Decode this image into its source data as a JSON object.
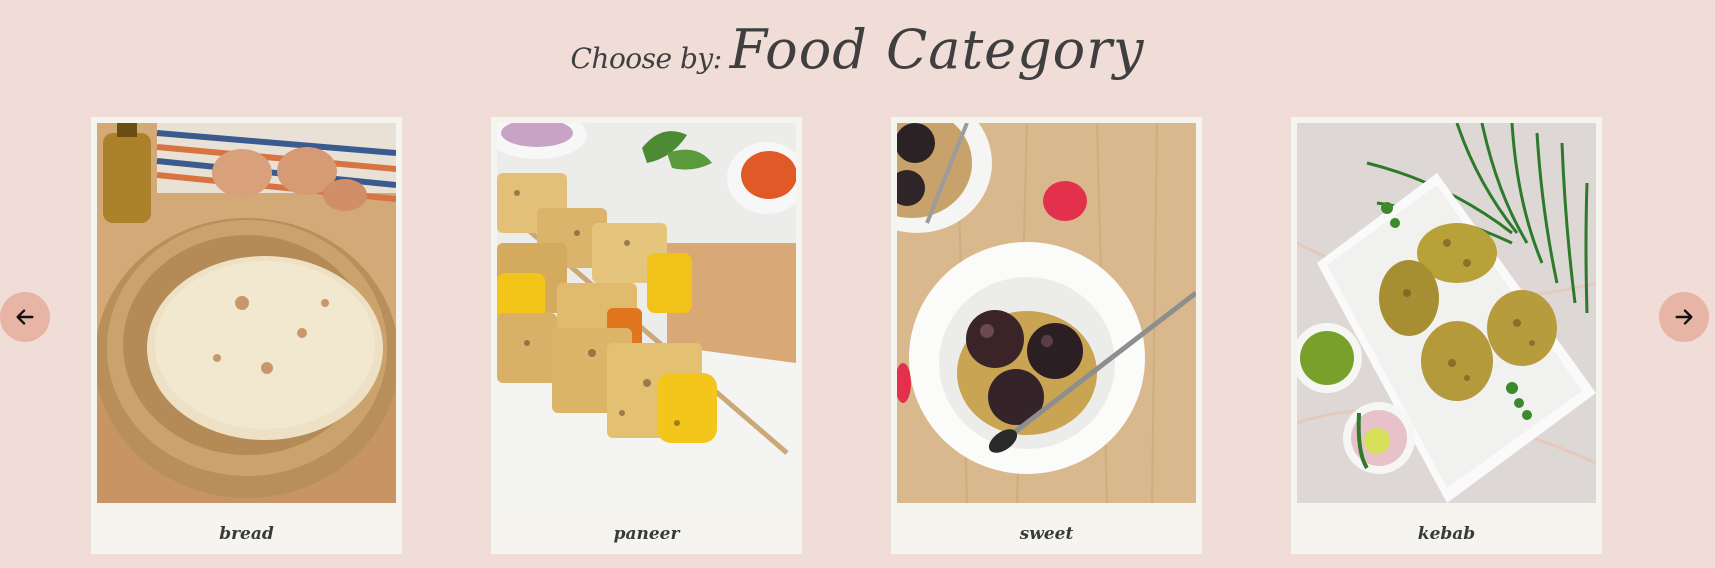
{
  "heading": {
    "prefix": "Choose by:",
    "title": "Food Category"
  },
  "carousel": {
    "prev_icon": "arrow-left-icon",
    "next_icon": "arrow-right-icon",
    "accent_color": "#e7b4a5",
    "items": [
      {
        "label": "bread",
        "image": "bread-photo"
      },
      {
        "label": "paneer",
        "image": "paneer-photo"
      },
      {
        "label": "sweet",
        "image": "sweet-photo"
      },
      {
        "label": "kebab",
        "image": "kebab-photo"
      }
    ]
  }
}
